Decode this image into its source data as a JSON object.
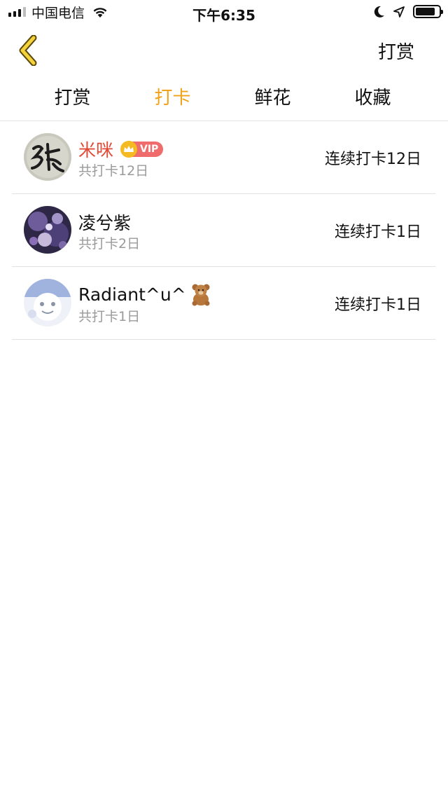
{
  "status_bar": {
    "carrier": "中国电信",
    "time": "下午6:35",
    "battery_level": 0.85
  },
  "nav": {
    "back_icon": "chevron-left-icon",
    "action_label": "打赏"
  },
  "tabs": [
    {
      "label": "打赏",
      "active": false
    },
    {
      "label": "打卡",
      "active": true
    },
    {
      "label": "鲜花",
      "active": false
    },
    {
      "label": "收藏",
      "active": false
    }
  ],
  "colors": {
    "accent": "#f0a21b",
    "vip_name": "#e14b36",
    "vip_badge": "#f06b6b",
    "secondary_text": "#9a9a9a"
  },
  "users": [
    {
      "name": "米咪",
      "vip": true,
      "vip_label": "VIP",
      "total": "共打卡12日",
      "streak": "连续打卡12日"
    },
    {
      "name": "凌兮紫",
      "vip": false,
      "total": "共打卡2日",
      "streak": "连续打卡1日"
    },
    {
      "name": "Radiant^u^",
      "vip": false,
      "emoji": "bear-icon",
      "total": "共打卡1日",
      "streak": "连续打卡1日"
    }
  ]
}
